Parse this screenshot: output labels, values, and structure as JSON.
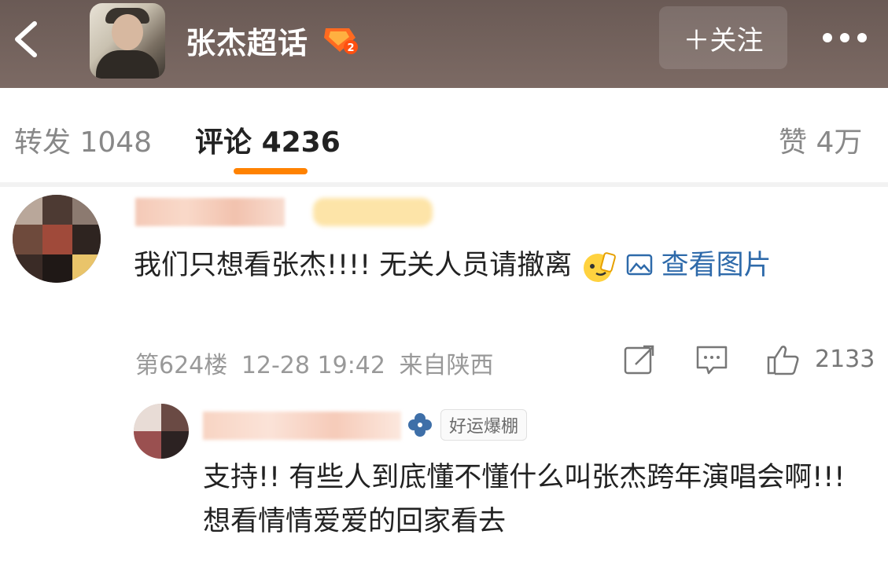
{
  "header": {
    "back_icon": "chevron-left-icon",
    "title": "张杰超话",
    "badge_level": "2",
    "follow_label": "＋关注",
    "more_icon": "more-dots-icon"
  },
  "tabs": {
    "repost": {
      "label": "转发",
      "count": "1048"
    },
    "comments": {
      "label": "评论",
      "count": "4236"
    },
    "likes": {
      "label": "赞",
      "count": "4万"
    }
  },
  "comment": {
    "text_main": "我们只想看张杰!!!! 无关人员请撤离",
    "view_image": "查看图片",
    "floor": "第624楼",
    "datetime": "12-28 19:42",
    "location": "来自陕西",
    "like_count": "2133"
  },
  "reply": {
    "badge_label": "好运爆棚",
    "text": "支持!! 有些人到底懂不懂什么叫张杰跨年演唱会啊!!! 想看情情爱爱的回家看去"
  },
  "colors": {
    "accent": "#ff8200",
    "link": "#2e6aaa",
    "header_bg": "#6a5a55"
  }
}
